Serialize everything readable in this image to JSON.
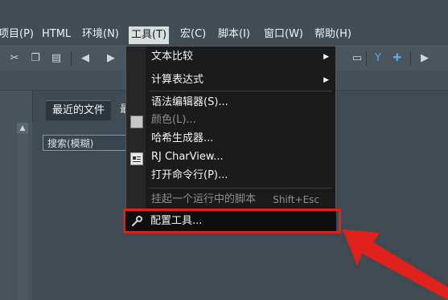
{
  "menubar": {
    "items": [
      "项目(P)",
      "HTML",
      "环境(N)",
      "工具(T)",
      "宏(C)",
      "脚本(I)",
      "窗口(W)",
      "帮助(H)"
    ],
    "active_index": 3
  },
  "sidebar": {
    "tab_recent": "最近的文件",
    "tab_more": "最",
    "search_placeholder": "搜索(模糊)"
  },
  "tools_menu": {
    "items": [
      {
        "label": "文本比较",
        "submenu": true,
        "enabled": true
      },
      {
        "label": "计算表达式",
        "submenu": true,
        "enabled": true
      },
      {
        "label": "语法编辑器(S)...",
        "enabled": true
      },
      {
        "label": "颜色(L)...",
        "enabled": false,
        "icon": "color-swatch-icon"
      },
      {
        "label": "哈希生成器...",
        "enabled": true
      },
      {
        "label": "RJ CharView...",
        "enabled": true,
        "icon": "charview-icon"
      },
      {
        "label": "打开命令行(P)...",
        "enabled": true
      },
      {
        "label": "挂起一个运行中的脚本",
        "shortcut": "Shift+Esc",
        "enabled": false
      },
      {
        "label": "配置工具...",
        "enabled": true,
        "icon": "wrench-icon",
        "highlighted": true
      }
    ]
  },
  "annotation": {
    "color": "#e0201a"
  }
}
